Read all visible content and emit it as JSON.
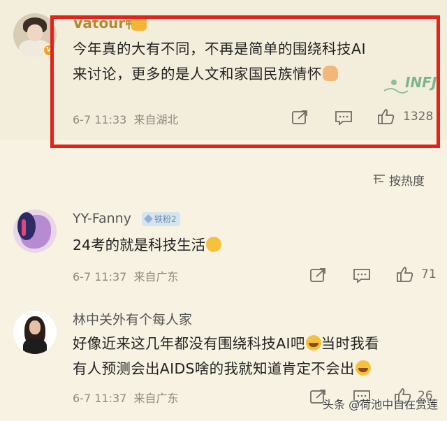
{
  "comments": [
    {
      "username": "Vatour鸭",
      "text_line1": "今年真的大有不同，不再是简单的围绕科技AI",
      "text_line2": "来讨论，更多的是人文和家国民族情怀",
      "date": "6-7 11:33",
      "location": "来自湖北",
      "likes": "1328",
      "sticker_text": "INFJ"
    },
    {
      "username": "YY-Fanny",
      "fan_badge": "铁粉2",
      "text": "24考的就是科技生活",
      "date": "6-7 11:37",
      "location": "来自广东",
      "likes": "71"
    },
    {
      "username": "林中关外有个每人家",
      "text_line1": "好像近来这几年都没有围绕科技AI吧",
      "text_line1b": "当时我看",
      "text_line2": "有人预测会出AIDS啥的我就知道肯定不会出",
      "date": "6-7 11:37",
      "location": "来自广东",
      "likes": "26"
    }
  ],
  "sort": {
    "label": "按热度"
  },
  "watermark": "头条 @荷池中自在赏莲",
  "colors": {
    "background": "#f7f2e1",
    "highlight_frame": "#e3231b",
    "username_gold": "#b08a35",
    "meta_gray": "#8c8a80"
  },
  "icons": [
    "share-icon",
    "comment-icon",
    "like-icon",
    "sort-icon"
  ]
}
